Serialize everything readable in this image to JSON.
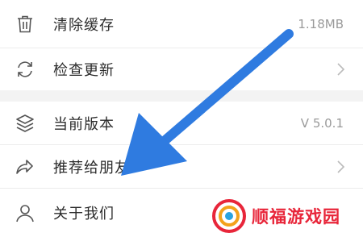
{
  "settings": {
    "items": [
      {
        "label": "清除缓存",
        "value": "1.18MB",
        "icon": "trash-icon"
      },
      {
        "label": "检查更新",
        "value": "",
        "icon": "refresh-icon"
      },
      {
        "label": "当前版本",
        "value": "V 5.0.1",
        "icon": "layers-icon"
      },
      {
        "label": "推荐给朋友",
        "value": "",
        "icon": "share-icon"
      },
      {
        "label": "关于我们",
        "value": "",
        "icon": "user-icon"
      }
    ]
  },
  "annotation": {
    "arrow_color": "#2f7be0"
  },
  "watermark": {
    "text": "顺福游戏园",
    "color": "#e8263a"
  }
}
